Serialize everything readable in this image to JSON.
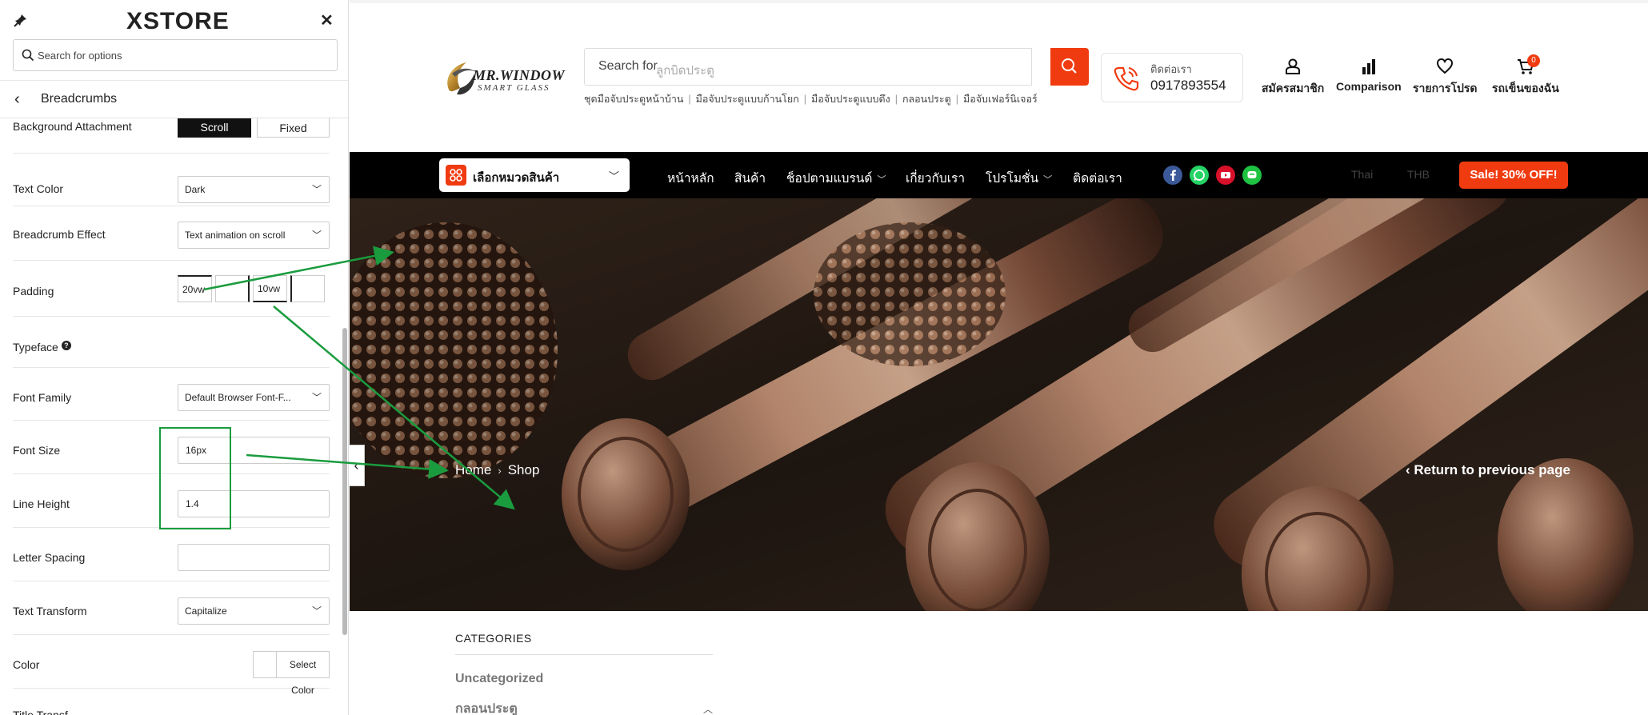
{
  "panel": {
    "brand": "XSTORE",
    "search_placeholder": "Search for options",
    "section_title": "Breadcrumbs",
    "options": {
      "background_attachment": {
        "label": "Background Attachment",
        "choices": [
          "Scroll",
          "Fixed"
        ],
        "selected": "Scroll"
      },
      "text_color": {
        "label": "Text Color",
        "value": "Dark"
      },
      "breadcrumb_effect": {
        "label": "Breadcrumb Effect",
        "value": "Text animation on scroll"
      },
      "padding": {
        "label": "Padding",
        "values": [
          "20vw",
          "",
          "10vw",
          ""
        ]
      },
      "typeface": {
        "label": "Typeface",
        "help": "?"
      },
      "font_family": {
        "label": "Font Family",
        "value": "Default Browser Font-F..."
      },
      "font_size": {
        "label": "Font Size",
        "value": "16px"
      },
      "line_height": {
        "label": "Line Height",
        "value": "1.4"
      },
      "letter_spacing": {
        "label": "Letter Spacing",
        "value": ""
      },
      "text_transform": {
        "label": "Text Transform",
        "value": "Capitalize"
      },
      "color": {
        "label": "Color",
        "button": "Select Color"
      },
      "title_transform": {
        "label": "Title Transf..."
      }
    }
  },
  "site": {
    "logo": {
      "line1": "MR.WINDOW",
      "line2": "SMART GLASS"
    },
    "search": {
      "label": "Search for",
      "placeholder": "ลูกบิดประตู"
    },
    "quick_links": [
      "ชุดมือจับประตูหน้าบ้าน",
      "มือจับประตูแบบก้านโยก",
      "มือจับประตูแบบดึง",
      "กลอนประตู",
      "มือจับเฟอร์นิเจอร์"
    ],
    "contact": {
      "label": "ติดต่อเรา",
      "phone": "0917893554"
    },
    "header_actions": {
      "account": "สมัครสมาชิก",
      "comparison": "Comparison",
      "wishlist": "รายการโปรด",
      "cart": "รถเข็นของฉัน",
      "cart_count": "0"
    },
    "category_button": "เลือกหมวดสินค้า",
    "nav": [
      "หน้าหลัก",
      "สินค้า",
      "ช็อปตามแบรนด์",
      "เกี่ยวกับเรา",
      "โปรโมชั่น",
      "ติดต่อเรา"
    ],
    "nav_dropdowns": [
      false,
      false,
      true,
      false,
      true,
      false
    ],
    "lang": [
      "Thai",
      "THB"
    ],
    "sale": "Sale! 30% OFF!",
    "breadcrumb": [
      "Home",
      "Shop"
    ],
    "return_link": "Return to previous page",
    "categories_title": "CATEGORIES",
    "categories": [
      "Uncategorized",
      "กลอนประตู"
    ]
  },
  "colors": {
    "accent": "#f03b10",
    "annotation": "#1a9c3e",
    "nav_bg": "#000000"
  },
  "icons": [
    "pin-icon",
    "close-icon",
    "search-icon",
    "back-icon",
    "chevron-down-icon",
    "help-icon",
    "phone-icon",
    "user-icon",
    "comparison-icon",
    "heart-icon",
    "cart-icon",
    "facebook-icon",
    "whatsapp-icon",
    "youtube-icon",
    "line-icon"
  ]
}
